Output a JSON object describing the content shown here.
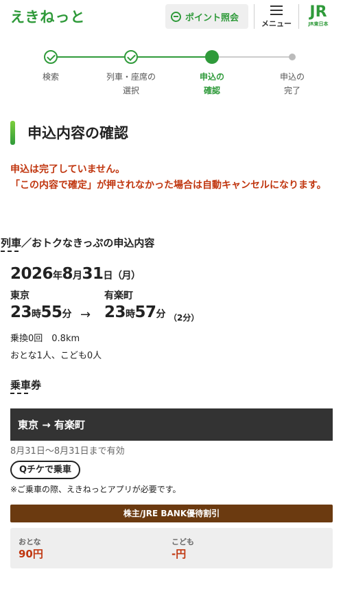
{
  "header": {
    "logo": "えきねっと",
    "points_label": "ポイント照会",
    "menu_label": "メニュー",
    "jr_mark": "JR",
    "jr_sub": "JR東日本"
  },
  "stepper": {
    "steps": [
      {
        "line1": "検索",
        "line2": "",
        "state": "done"
      },
      {
        "line1": "列車・座席の",
        "line2": "選択",
        "state": "done"
      },
      {
        "line1": "申込の",
        "line2": "確認",
        "state": "current"
      },
      {
        "line1": "申込の",
        "line2": "完了",
        "state": "todo"
      }
    ]
  },
  "page_title": "申込内容の確認",
  "warning": {
    "line1": "申込は完了していません。",
    "line2": "「この内容で確定」が押されなかった場合は自動キャンセルになります。"
  },
  "trip_section": {
    "heading": "列車／おトクなきっぷの申込内容",
    "date": {
      "year": "2026",
      "y": "年",
      "month": "8",
      "m": "月",
      "day": "31",
      "d": "日",
      "weekday": "（月）"
    },
    "from": {
      "station": "東京",
      "hour": "23",
      "h": "時",
      "minute": "55",
      "mi": "分"
    },
    "arrow": "→",
    "to": {
      "station": "有楽町",
      "hour": "23",
      "h": "時",
      "minute": "57",
      "mi": "分",
      "duration": "（2分）"
    },
    "transfer": "乗換0回　0.8km",
    "passengers": "おとな1人、こども0人"
  },
  "ticket_section": {
    "heading": "乗車券",
    "route": "東京 → 有楽町",
    "validity": "8月31日〜8月31日まで有効",
    "q_ticket": "Qチケで乗車",
    "note": "※ご乗車の際、えきねっとアプリが必要です。",
    "discount": "株主/JRE BANK優待割引",
    "fares": [
      {
        "label": "おとな",
        "value": "90円"
      },
      {
        "label": "こども",
        "value": "-円"
      }
    ]
  },
  "colors": {
    "brand_green": "#2f9a3a",
    "warning_red": "#c0360f",
    "route_band": "#333333",
    "discount_band": "#6b3a10"
  }
}
